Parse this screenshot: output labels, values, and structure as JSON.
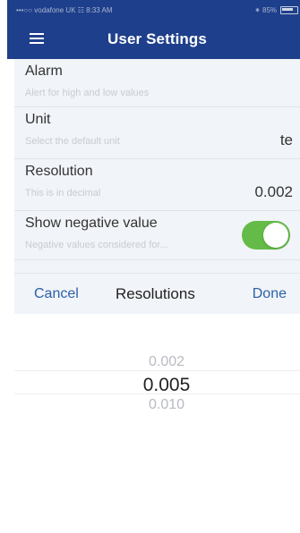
{
  "status_bar": {
    "left_text": "•••○○ vodafone UK ☷ 8:33 AM",
    "right_text": "⁕ 85%"
  },
  "header": {
    "title": "User Settings"
  },
  "settings": {
    "alarm": {
      "title": "Alarm",
      "description": "Alert for high and low values"
    },
    "unit": {
      "title": "Unit",
      "description": "Select the default unit",
      "value": "te"
    },
    "resolution": {
      "title": "Resolution",
      "description": "This is in decimal",
      "value": "0.002"
    },
    "negative": {
      "title": "Show negative value",
      "description": "Negative values considered for...",
      "enabled": true
    }
  },
  "picker": {
    "cancel_label": "Cancel",
    "title": "Resolutions",
    "done_label": "Done",
    "options": [
      "0.002",
      "0.005",
      "0.010"
    ],
    "selected_index": 1
  },
  "colors": {
    "nav_background": "#1e3f8b",
    "toggle_on": "#64bb48",
    "action_text": "#2b5fa7"
  },
  "icons": {
    "menu": "hamburger-icon",
    "battery": "battery-icon"
  }
}
